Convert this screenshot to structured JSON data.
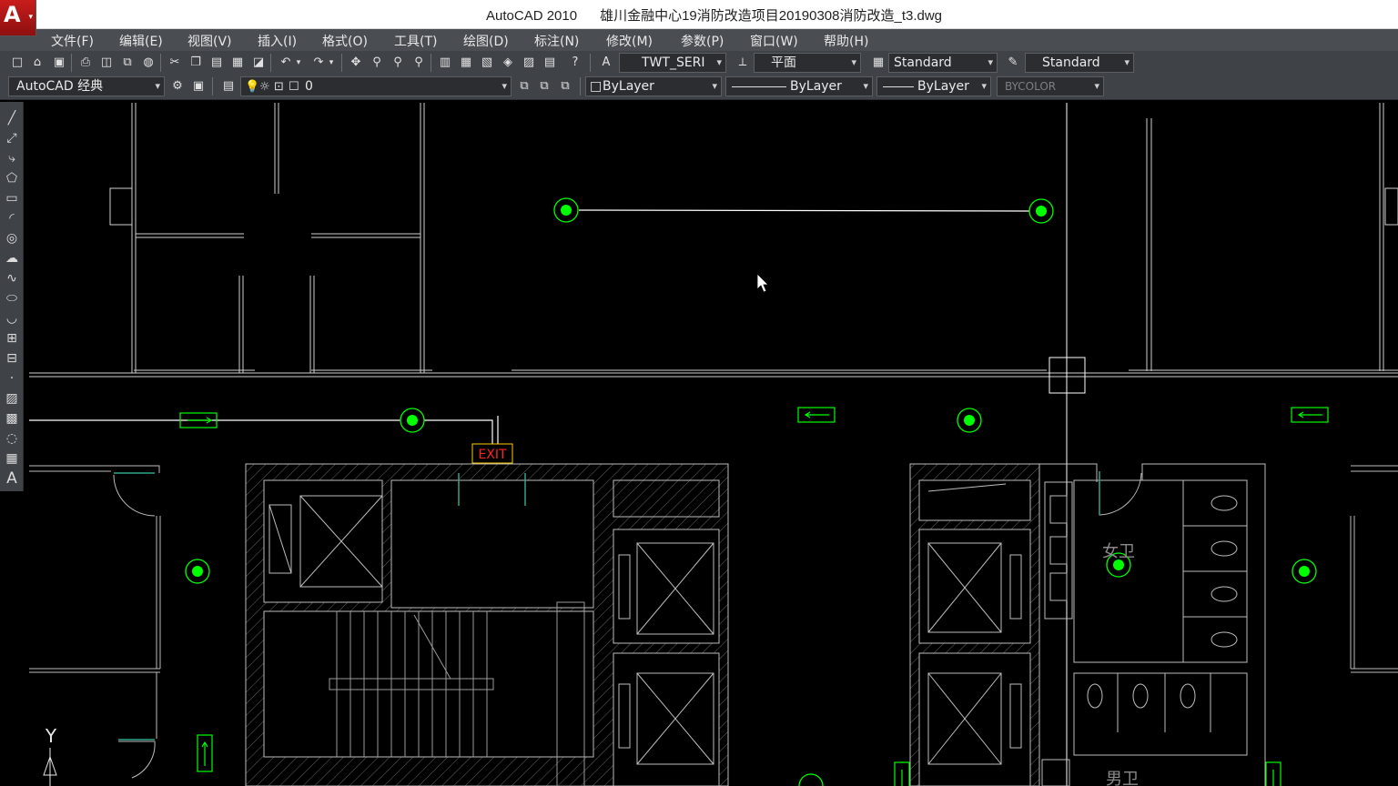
{
  "window": {
    "title": "AutoCAD 2010      雄川金融中心19消防改造项目20190308消防改造_t3.dwg",
    "logo_letter": "A"
  },
  "menu": [
    "文件(F)",
    "编辑(E)",
    "视图(V)",
    "插入(I)",
    "格式(O)",
    "工具(T)",
    "绘图(D)",
    "标注(N)",
    "修改(M)",
    "参数(P)",
    "窗口(W)",
    "帮助(H)"
  ],
  "toolbar": {
    "text_style": "TWT_SERI",
    "view_style": "平面",
    "dim_style": "Standard",
    "table_style": "Standard",
    "workspace": "AutoCAD 经典",
    "layer": "0",
    "color": "ByLayer",
    "linetype": "ByLayer",
    "lineweight": "ByLayer",
    "plot_style": "BYCOLOR"
  },
  "drawing": {
    "exit_sign_label": "EXIT",
    "room_female_wc": "女卫",
    "room_male_wc": "男卫",
    "ucs_y_label": "Y"
  },
  "colors": {
    "accent_green": "#00ff00",
    "linework": "#ffffff",
    "hatch": "#8a8a8a",
    "exit_sign": "#ff2222",
    "exit_frame": "#ffcc00",
    "menu_bg": "#4a4e53",
    "toolbar_bg": "#3f4247"
  },
  "icons": [
    "autocad-logo-icon",
    "new-icon",
    "open-icon",
    "save-icon",
    "print-icon",
    "preview-icon",
    "cut-icon",
    "copy-icon",
    "paste-icon",
    "undo-icon",
    "redo-icon",
    "pan-icon",
    "zoom-icon",
    "help-icon",
    "line-icon",
    "circle-icon",
    "text-icon",
    "layer-icon",
    "cursor-icon"
  ]
}
